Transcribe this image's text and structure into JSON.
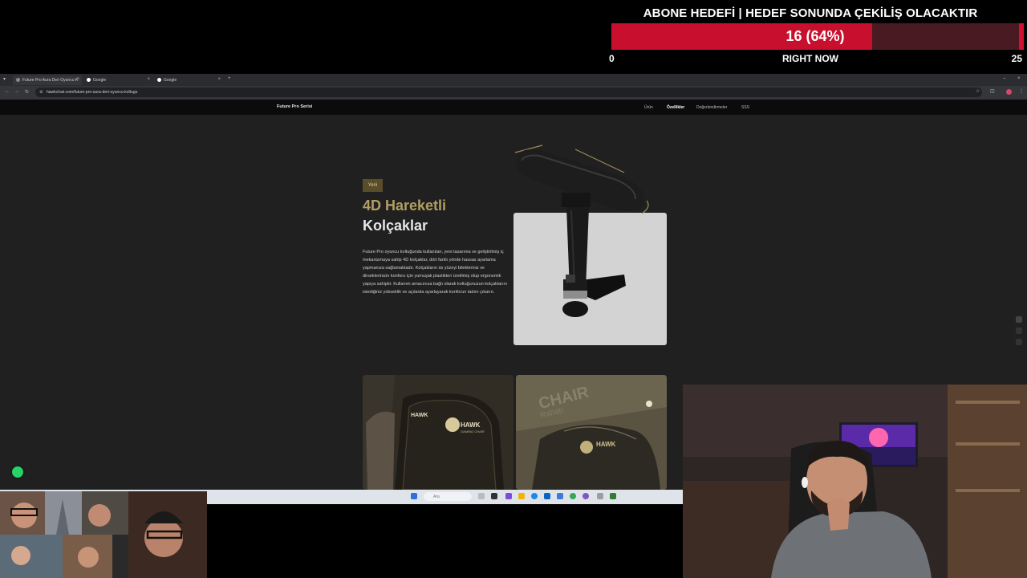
{
  "overlay": {
    "goal_title": "ABONE HEDEFİ | HEDEF SONUNDA ÇEKİLİŞ OLACAKTIR",
    "goal_value_text": "16 (64%)",
    "goal_progress": 0.64,
    "goal_min": "0",
    "goal_now": "RIGHT NOW",
    "goal_max": "25",
    "colors": {
      "fill": "#c8102e",
      "track": "#4a1a22"
    }
  },
  "browser": {
    "tabs": [
      {
        "label": "Future Pro Aura Deri Oyuncu K"
      },
      {
        "label": "Google"
      },
      {
        "label": "Google"
      }
    ],
    "url": "hawkchair.com/future-pro-aura-deri-oyuncu-koltugu",
    "icons": [
      "back-arrow-icon",
      "forward-arrow-icon",
      "reload-icon",
      "star-icon",
      "extensions-icon",
      "profile-icon",
      "menu-icon"
    ]
  },
  "site": {
    "brand": "Future Pro Serisi",
    "nav": [
      "Ürün",
      "Özellikler",
      "Değerlendirmeler",
      "SSS"
    ],
    "active_nav": "Özellikler",
    "badge": "Yeni",
    "heading_line1": "4D Hareketli",
    "heading_line2": "Kolçaklar",
    "description": "Future Pro oyuncu koltuğunda kullanılan, yeni tasarıma ve geliştirilmiş iç mekanizmaya sahip 4D kolçaklar, dört farklı yönde hassas ayarlama yapmanıza sağlamaktadır. Kolçakların üs yüzeyi bilekleriniz ve dirseklerinizin konforu için yumuşak plastikten üretilmiş olup ergonomik yapıya sahiptir. Kullanım amacınıza bağlı olarak koltuğunuzun kolçaklarını istediğiniz yükseklik ve açılarda ayarlayarak konforun tadını çıkarın.",
    "card_brand": "HAWK",
    "card_sub": "GAMING CHAIR",
    "card_bg_text": "CHAIR",
    "card_bg_text2": "Rahatı"
  },
  "taskbar": {
    "search_placeholder": "Ara"
  }
}
